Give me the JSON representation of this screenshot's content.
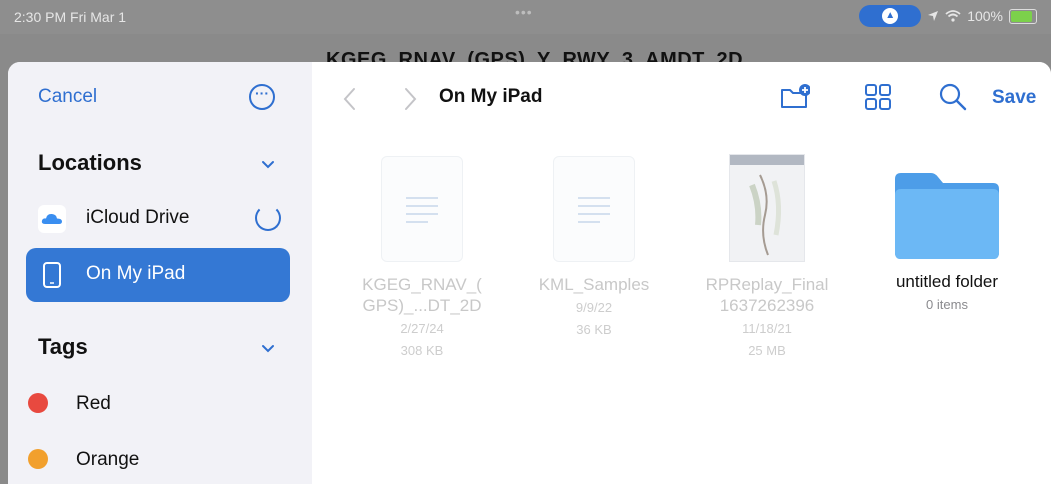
{
  "status_bar": {
    "time": "2:30 PM  Fri Mar 1",
    "dots": "•••",
    "battery": "100%",
    "nav_glyph": "▲"
  },
  "background_app": {
    "title": "KGEG_RNAV_(GPS)_Y_RWY_3_AMDT_2D"
  },
  "sidebar": {
    "cancel_label": "Cancel",
    "more_label": "···",
    "locations_title": "Locations",
    "locations": [
      {
        "label": "iCloud Drive",
        "icon": "icloud-icon",
        "loading": true
      },
      {
        "label": "On My iPad",
        "icon": "ipad-icon",
        "selected": true
      }
    ],
    "tags_title": "Tags",
    "tags": [
      {
        "label": "Red",
        "color": "#e8493f"
      },
      {
        "label": "Orange",
        "color": "#f2a02d"
      }
    ]
  },
  "toolbar": {
    "title": "On My iPad",
    "save_label": "Save",
    "icons": [
      "back-icon",
      "forward-icon",
      "new-folder-icon",
      "grid-view-icon",
      "search-icon"
    ]
  },
  "files": [
    {
      "name_line1": "KGEG_RNAV_(",
      "name_line2": "GPS)_...DT_2D",
      "date": "2/27/24",
      "size": "308 KB",
      "type": "document",
      "enabled": false
    },
    {
      "name_line1": "KML_Samples",
      "name_line2": "",
      "date": "9/9/22",
      "size": "36 KB",
      "type": "document",
      "enabled": false
    },
    {
      "name_line1": "RPReplay_Final",
      "name_line2": "1637262396",
      "date": "11/18/21",
      "size": "25 MB",
      "type": "image",
      "enabled": false
    },
    {
      "name_line1": "untitled folder",
      "name_line2": "",
      "date": "0 items",
      "size": "",
      "type": "folder",
      "enabled": true
    }
  ],
  "colors": {
    "accent": "#2f6fd0",
    "selected_row": "#3478d4",
    "folder": "#5aaaf0"
  }
}
